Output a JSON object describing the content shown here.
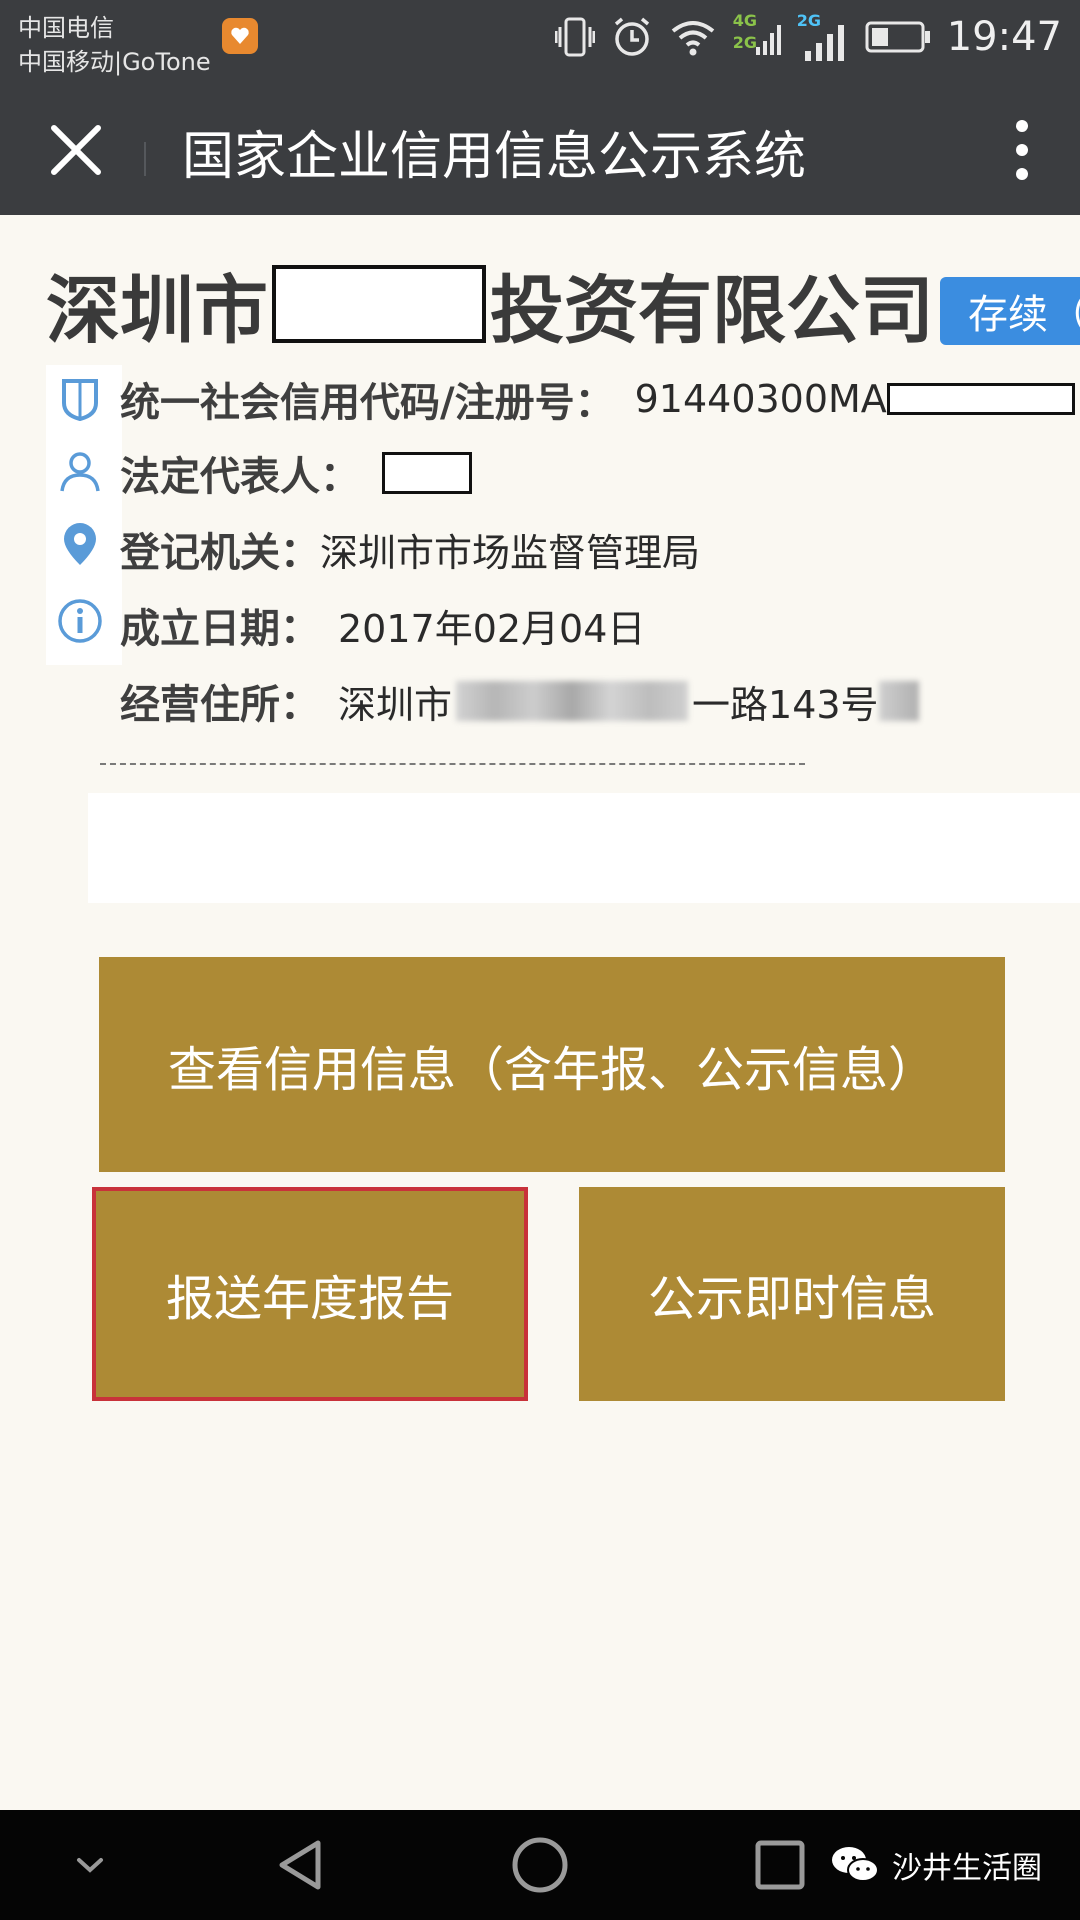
{
  "status_bar": {
    "carrier_1": "中国电信",
    "carrier_2": "中国移动|GoTone",
    "network_top": "4G",
    "network_bottom": "2G",
    "network_2": "2G",
    "time": "19:47",
    "icons": [
      "app-notification-icon",
      "vibrate-icon",
      "alarm-icon",
      "wifi-icon",
      "signal-icon",
      "battery-icon"
    ]
  },
  "title_bar": {
    "title": "国家企业信用信息公示系统",
    "icons": [
      "close-icon",
      "more-vert-icon"
    ]
  },
  "company": {
    "name_prefix": "深圳市",
    "name_suffix": "投资有限公司",
    "status_tag": "存续（"
  },
  "info": {
    "credit_code_label": "统一社会信用代码/注册号：",
    "credit_code_value": "91440300MA",
    "legal_rep_label": "法定代表人：",
    "authority_label": "登记机关：",
    "authority_value": "深圳市市场监督管理局",
    "founded_label": "成立日期：",
    "founded_value": "2017年02月04日",
    "address_label": "经营住所：",
    "address_prefix": "深圳市",
    "address_mid": "一路143号",
    "icons": [
      "shield-icon",
      "person-icon",
      "location-icon",
      "info-icon"
    ]
  },
  "actions": {
    "view_credit": "查看信用信息（含年报、公示信息）",
    "submit_annual": "报送年度报告",
    "publish_instant": "公示即时信息"
  },
  "nav_bar": {
    "watermark": "沙井生活圈",
    "icons": [
      "chevron-down-icon",
      "back-icon",
      "home-icon",
      "recents-icon",
      "wechat-icon"
    ]
  },
  "colors": {
    "bar_bg": "#3b3d40",
    "page_bg": "#faf8f2",
    "button_gold": "#ad8a35",
    "tag_blue": "#3b8de0",
    "highlight_red": "#c8323a",
    "icon_blue": "#5a9bd8"
  }
}
